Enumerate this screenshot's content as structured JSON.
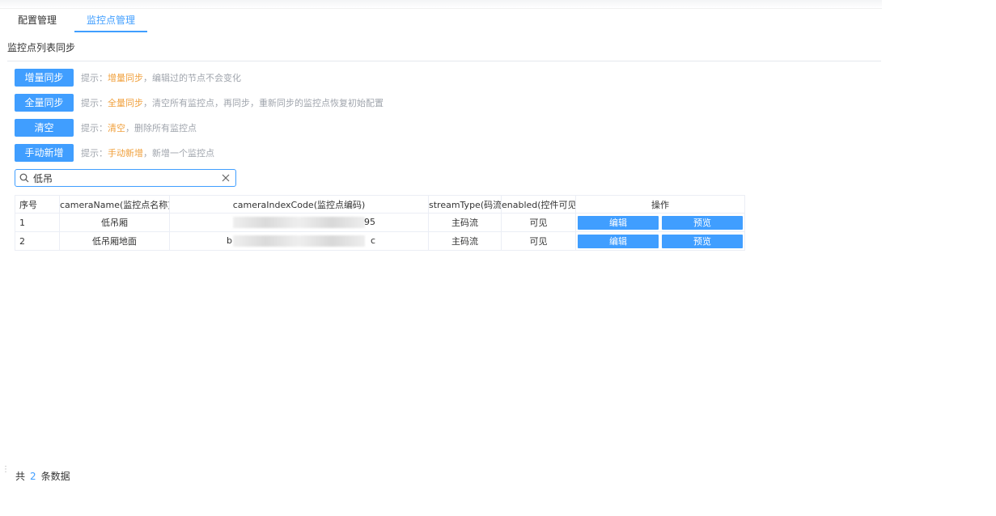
{
  "tabs": [
    {
      "label": "配置管理",
      "active": false
    },
    {
      "label": "监控点管理",
      "active": true
    }
  ],
  "section_title": "监控点列表同步",
  "actions": [
    {
      "button": "增量同步",
      "hint_prefix": "提示：",
      "hint_highlight": "增量同步",
      "hint_suffix": "，编辑过的节点不会变化"
    },
    {
      "button": "全量同步",
      "hint_prefix": "提示：",
      "hint_highlight": "全量同步",
      "hint_suffix": "，清空所有监控点，再同步，重新同步的监控点恢复初始配置"
    },
    {
      "button": "清空",
      "hint_prefix": "提示：",
      "hint_highlight": "清空",
      "hint_suffix": "，删除所有监控点"
    },
    {
      "button": "手动新增",
      "hint_prefix": "提示：",
      "hint_highlight": "手动新增",
      "hint_suffix": "，新增一个监控点"
    }
  ],
  "search": {
    "value": "低吊",
    "placeholder": ""
  },
  "table": {
    "headers": [
      "序号",
      "cameraName(监控点名称)",
      "cameraIndexCode(监控点编码)",
      "streamType(码流)",
      "enabled(控件可见)",
      "操作"
    ],
    "rows": [
      {
        "index": "1",
        "cameraName": "低吊厢",
        "cameraIndexCode_visible_start": "",
        "cameraIndexCode_visible_end": "95",
        "streamType": "主码流",
        "enabled": "可见",
        "edit": "编辑",
        "preview": "预览"
      },
      {
        "index": "2",
        "cameraName": "低吊厢地面",
        "cameraIndexCode_visible_start": "b",
        "cameraIndexCode_visible_end": "c",
        "streamType": "主码流",
        "enabled": "可见",
        "edit": "编辑",
        "preview": "预览"
      }
    ]
  },
  "footer": {
    "prefix": "共",
    "count": "2",
    "suffix": "条数据"
  },
  "colors": {
    "primary": "#409eff",
    "highlight": "#f0a03c",
    "hint": "#a0a5ad"
  },
  "icons": {
    "search": "search-icon",
    "clear": "close-icon",
    "footer": "drag-handle-icon"
  }
}
